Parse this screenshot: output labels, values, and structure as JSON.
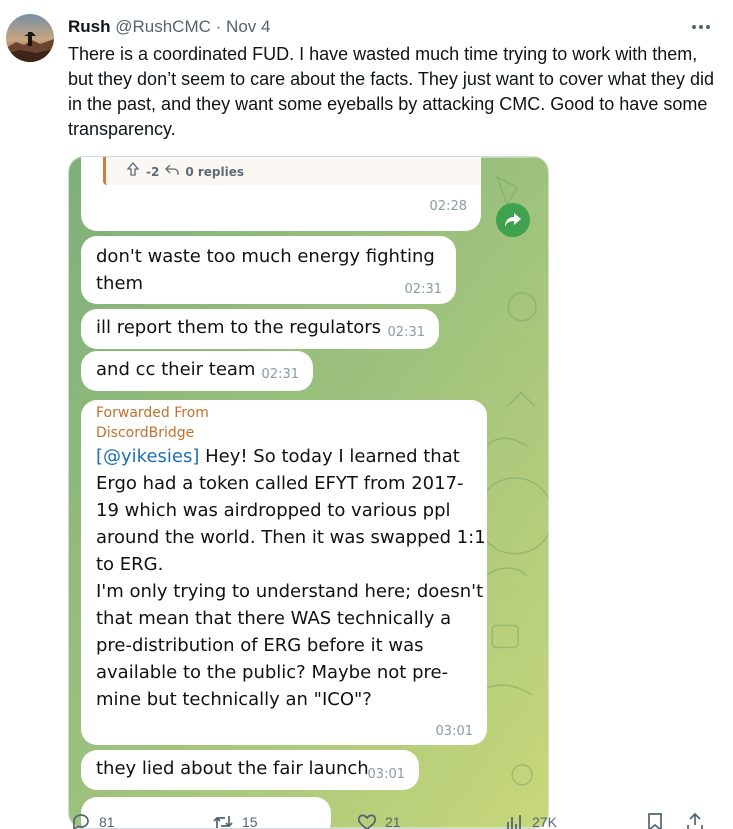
{
  "author": {
    "name": "Rush",
    "handle": "@RushCMC",
    "separator": "·",
    "date": "Nov 4"
  },
  "tweet_text": "There is a coordinated FUD. I have wasted much time trying to work with them, but they don’t seem to care about the facts. They just want to cover what they did in the past, and they want some eyeballs by attacking CMC. Good to have some transparency.",
  "screenshot": {
    "reply_card": {
      "score": "-2",
      "replies": "0 replies"
    },
    "messages": [
      {
        "text": "",
        "time": "02:28"
      },
      {
        "text": "don't waste too much energy fighting them",
        "time": "02:31"
      },
      {
        "text": "ill report them to the regulators",
        "time": "02:31"
      },
      {
        "text": "and cc their team",
        "time": "02:31"
      },
      {
        "forwarded_label": "Forwarded From",
        "forwarded_source": "DiscordBridge",
        "mention": "[@yikesies]",
        "text": " Hey! So today I learned that Ergo had a token called EFYT from 2017-19 which was airdropped to various ppl around the world. Then it was swapped 1:1 to ERG.\nI'm only trying to understand here; doesn't that mean that there WAS technically a pre-distribution of ERG before it was available to the public? Maybe not pre-mine but technically an \"ICO\"?",
        "time": "03:01"
      },
      {
        "text": "they lied about the fair launch",
        "time": "03:01"
      }
    ]
  },
  "actions": {
    "replies": "81",
    "reposts": "15",
    "likes": "21",
    "views": "27K"
  },
  "colors": {
    "accent_forward": "#c66f2a",
    "mention": "#1d6fb8",
    "share": "#3fa24f"
  }
}
